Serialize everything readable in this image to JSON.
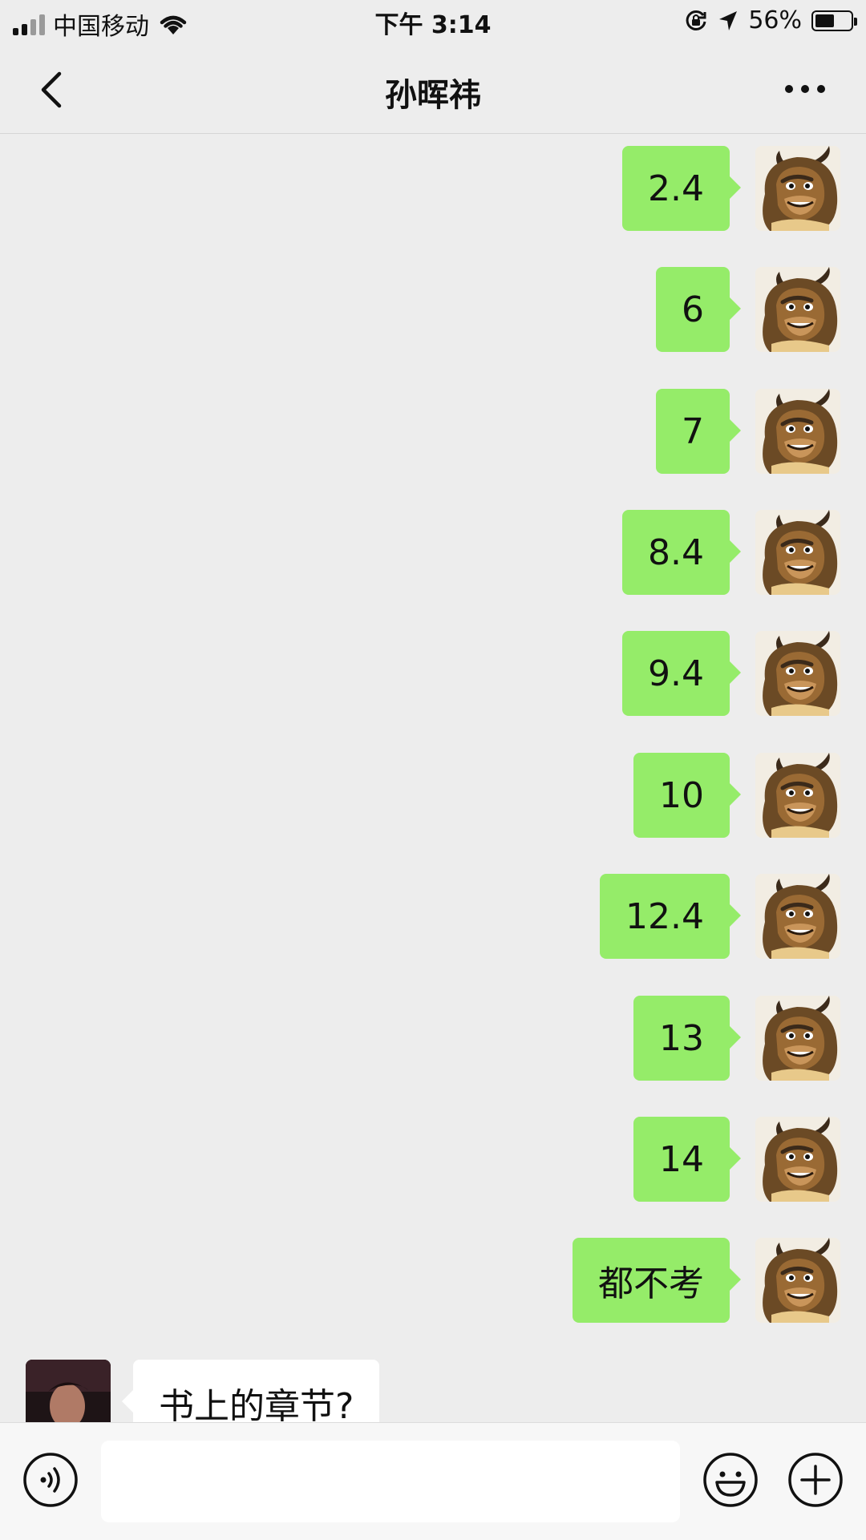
{
  "status_bar": {
    "carrier": "中国移动",
    "time": "下午 3:14",
    "battery_percent": "56%",
    "battery_level": 0.56,
    "signal_bars_active": 2,
    "signal_bars_total": 4,
    "icons": [
      "signal-icon",
      "wifi-icon",
      "orientation-lock-icon",
      "location-arrow-icon",
      "battery-icon"
    ]
  },
  "nav": {
    "title": "孙晖祎",
    "back_icon": "chevron-left-icon",
    "more_icon": "more-dots-icon"
  },
  "messages": [
    {
      "side": "right",
      "text": "2.4",
      "avatar": "beast-avatar"
    },
    {
      "side": "right",
      "text": "6",
      "avatar": "beast-avatar"
    },
    {
      "side": "right",
      "text": "7",
      "avatar": "beast-avatar"
    },
    {
      "side": "right",
      "text": "8.4",
      "avatar": "beast-avatar"
    },
    {
      "side": "right",
      "text": "9.4",
      "avatar": "beast-avatar"
    },
    {
      "side": "right",
      "text": "10",
      "avatar": "beast-avatar"
    },
    {
      "side": "right",
      "text": "12.4",
      "avatar": "beast-avatar"
    },
    {
      "side": "right",
      "text": "13",
      "avatar": "beast-avatar"
    },
    {
      "side": "right",
      "text": "14",
      "avatar": "beast-avatar"
    },
    {
      "side": "right",
      "text": "都不考",
      "avatar": "beast-avatar"
    },
    {
      "side": "left",
      "text": "书上的章节?",
      "avatar": "contact-avatar"
    }
  ],
  "input_bar": {
    "value": "",
    "placeholder": "",
    "icons": [
      "voice-icon",
      "emoji-icon",
      "plus-icon"
    ]
  },
  "colors": {
    "background": "#ededed",
    "bubble_sent": "#95ec69",
    "bubble_received": "#ffffff",
    "input_bar": "#f7f7f7"
  }
}
